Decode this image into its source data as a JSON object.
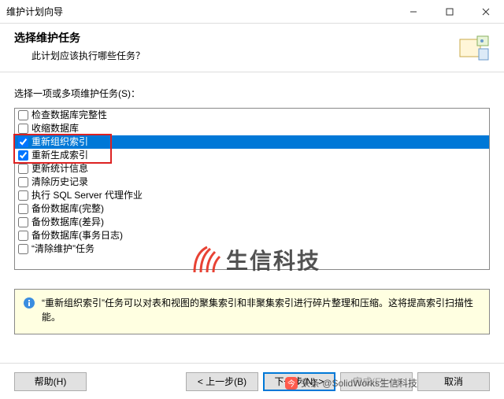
{
  "titlebar": {
    "title": "维护计划向导"
  },
  "header": {
    "title": "选择维护任务",
    "subtitle": "此计划应该执行哪些任务？"
  },
  "prompt": "选择一项或多项维护任务(S)：",
  "tasks": [
    {
      "label": "检查数据库完整性",
      "checked": false,
      "selected": false
    },
    {
      "label": "收缩数据库",
      "checked": false,
      "selected": false
    },
    {
      "label": "重新组织索引",
      "checked": true,
      "selected": true
    },
    {
      "label": "重新生成索引",
      "checked": true,
      "selected": false
    },
    {
      "label": "更新统计信息",
      "checked": false,
      "selected": false
    },
    {
      "label": "清除历史记录",
      "checked": false,
      "selected": false
    },
    {
      "label": "执行 SQL Server 代理作业",
      "checked": false,
      "selected": false
    },
    {
      "label": "备份数据库(完整)",
      "checked": false,
      "selected": false
    },
    {
      "label": "备份数据库(差异)",
      "checked": false,
      "selected": false
    },
    {
      "label": "备份数据库(事务日志)",
      "checked": false,
      "selected": false
    },
    {
      "label": "“清除维护”任务",
      "checked": false,
      "selected": false
    }
  ],
  "description": "“重新组织索引”任务可以对表和视图的聚集索引和非聚集索引进行碎片整理和压缩。这将提高索引扫描性能。",
  "buttons": {
    "help": "帮助(H)",
    "back": "< 上一步(B)",
    "next": "下一步(N) >",
    "finish": "完成(F) >>|",
    "cancel": "取消"
  },
  "watermark": {
    "text": "生信科技"
  },
  "credit": "头条 @SolidWorks生信科技"
}
